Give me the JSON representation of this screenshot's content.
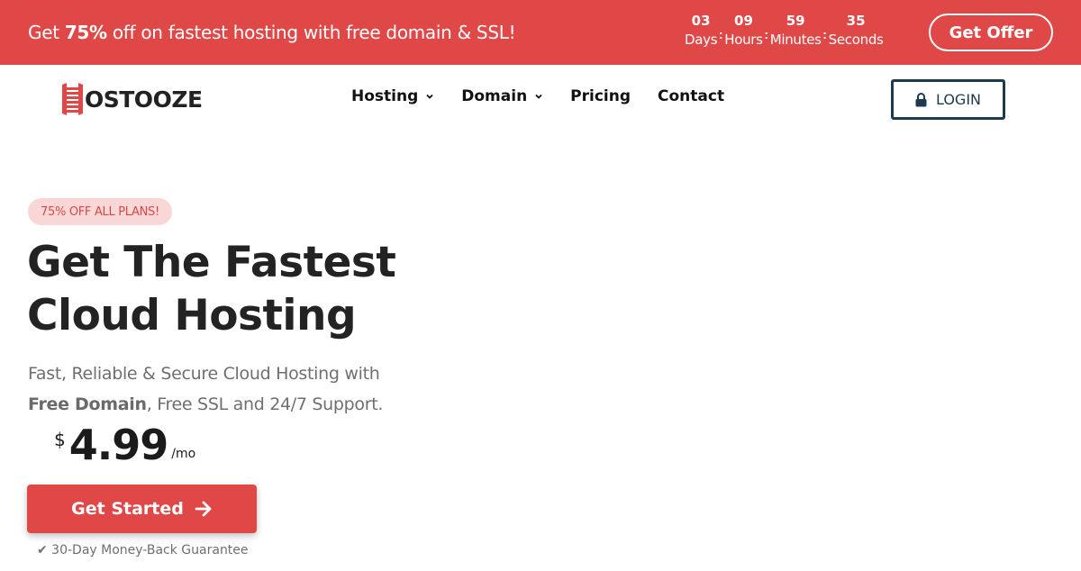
{
  "promo": {
    "text_before": "Get ",
    "text_bold": "75%",
    "text_after": " off on fastest hosting with free domain & SSL!",
    "countdown": [
      {
        "value": "03",
        "label": "Days"
      },
      {
        "value": "09",
        "label": "Hours"
      },
      {
        "value": "59",
        "label": "Minutes"
      },
      {
        "value": "35",
        "label": "Seconds"
      }
    ],
    "separator": ":",
    "cta_label": "Get Offer",
    "bg_color": "#e04848"
  },
  "header": {
    "logo_text": "OSTOOZE",
    "logo_icon": "ladder-h-icon",
    "nav": [
      {
        "label": "Hosting",
        "has_dropdown": true
      },
      {
        "label": "Domain",
        "has_dropdown": true
      },
      {
        "label": "Pricing",
        "has_dropdown": false
      },
      {
        "label": "Contact",
        "has_dropdown": false
      }
    ],
    "login_label": "LOGIN",
    "login_icon": "lock-icon"
  },
  "hero": {
    "badge": "75% OFF ALL PLANS!",
    "headline_line1": "Get The Fastest",
    "headline_line2": "Cloud Hosting",
    "sub_line1": "Fast, Reliable & Secure Cloud Hosting with",
    "sub_bold": "Free Domain",
    "sub_line2_rest": ", Free SSL and 24/7 Support.",
    "price_currency": "$",
    "price_amount": "4.99",
    "price_period": "/mo",
    "cta_label": "Get Started",
    "cta_icon": "arrow-right-icon",
    "guarantee": "✔ 30-Day Money-Back Guarantee",
    "accent_color": "#e04848"
  }
}
